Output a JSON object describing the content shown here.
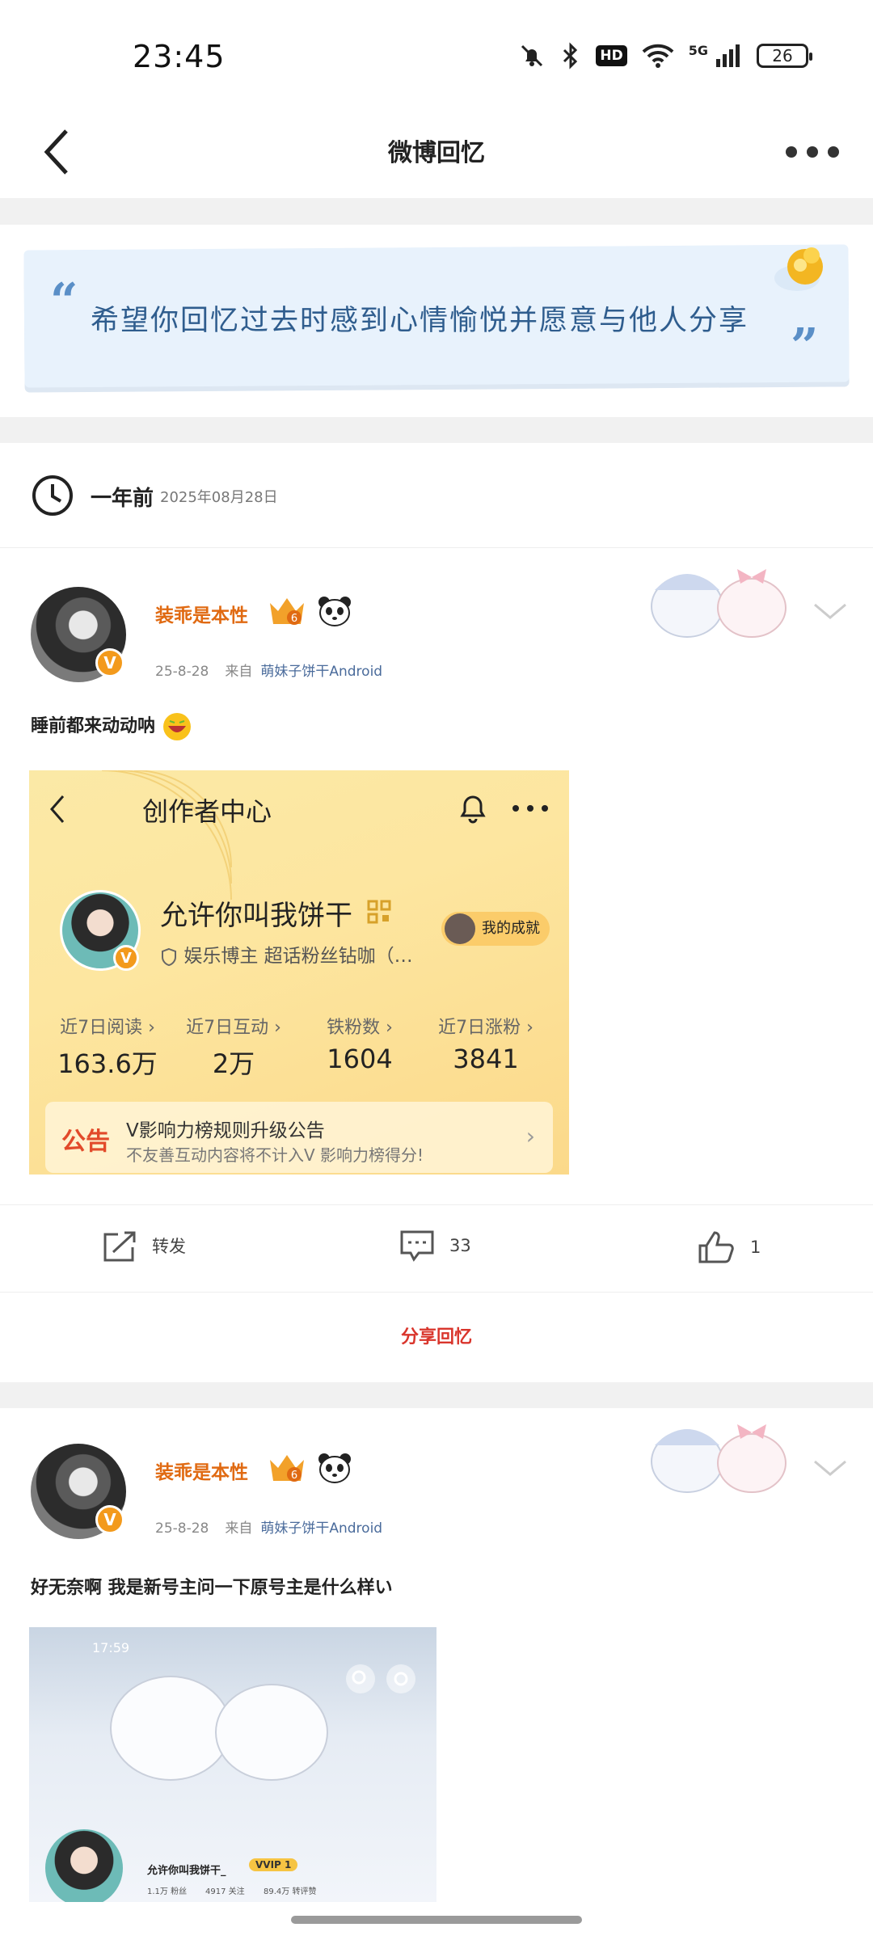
{
  "status": {
    "time": "23:45",
    "hd": "HD",
    "network": "5G",
    "battery": "26"
  },
  "nav": {
    "title": "微博回忆"
  },
  "banner": {
    "quote": "希望你回忆过去时感到心情愉悦并愿意与他人分享"
  },
  "memory": {
    "ago": "一年前",
    "date": "2025年08月28日"
  },
  "posts": [
    {
      "user": "装乖是本性",
      "level": "6",
      "date": "25-8-28",
      "source_prefix": "来自",
      "source": "萌妹子饼干Android",
      "text": "睡前都来动动呐",
      "image": {
        "title": "创作者中心",
        "name": "允许你叫我饼干",
        "sub": "娱乐博主 超话粉丝钻咖（…",
        "achievement": "我的成就",
        "stats": [
          {
            "label": "近7日阅读 ›",
            "value": "163.6万"
          },
          {
            "label": "近7日互动 ›",
            "value": "2万"
          },
          {
            "label": "铁粉数 ›",
            "value": "1604"
          },
          {
            "label": "近7日涨粉 ›",
            "value": "3841"
          }
        ],
        "notice_tag": "公告",
        "notice_title": "V影响力榜规则升级公告",
        "notice_sub": "不友善互动内容将不计入V 影响力榜得分!"
      },
      "actions": {
        "repost": "转发",
        "comments": "33",
        "likes": "1"
      }
    },
    {
      "user": "装乖是本性",
      "level": "6",
      "date": "25-8-28",
      "source_prefix": "来自",
      "source": "萌妹子饼干Android",
      "text": "好无奈啊 我是新号主问一下原号主是什么样い",
      "image": {
        "time": "17:59",
        "name": "允许你叫我饼干_",
        "vip": "VVIP 1",
        "stats": [
          "1.1万 粉丝",
          "4917 关注",
          "89.4万 转评赞"
        ]
      }
    }
  ],
  "share_memory": "分享回忆",
  "colors": {
    "accent": "#e06a12",
    "share": "#d9352c",
    "link": "#4a6b9b"
  }
}
